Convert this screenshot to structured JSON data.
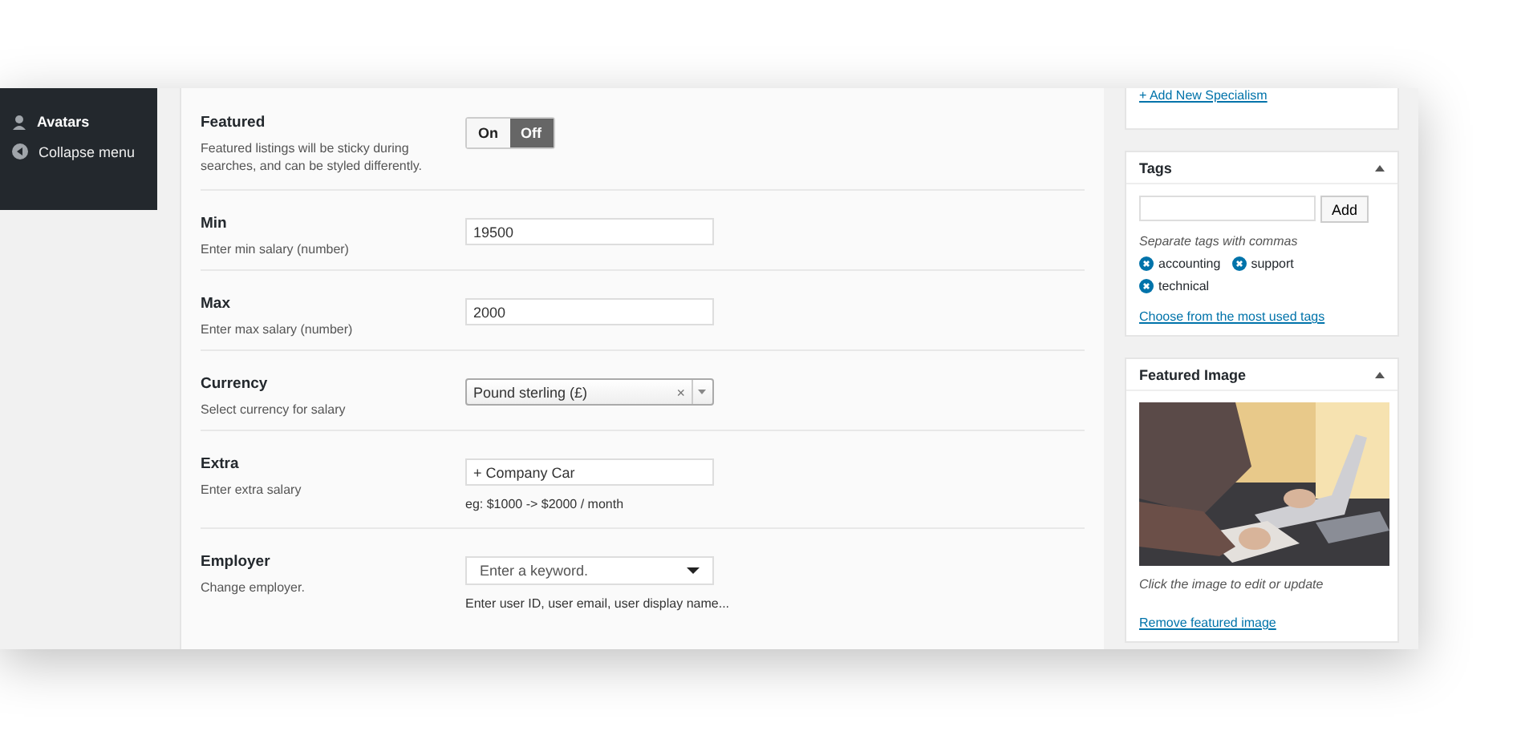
{
  "sidebar": {
    "items": [
      {
        "label": "Avatars",
        "selected": true
      },
      {
        "label": "Collapse menu",
        "selected": false
      }
    ]
  },
  "fields": [
    {
      "kind": "toggle",
      "label": "Featured",
      "description": "Featured listings will be sticky during searches, and can be styled differently.",
      "options": [
        {
          "label": "On",
          "selected": false
        },
        {
          "label": "Off",
          "selected": true
        }
      ]
    },
    {
      "kind": "text",
      "label": "Min",
      "description": "Enter min salary (number)",
      "value": "19500"
    },
    {
      "kind": "text",
      "label": "Max",
      "description": "Enter max salary (number)",
      "value": "2000"
    },
    {
      "kind": "select",
      "label": "Currency",
      "description": "Select currency for salary",
      "value": "Pound sterling (£)",
      "clear": "×"
    },
    {
      "kind": "text",
      "label": "Extra",
      "description": "Enter extra salary",
      "value": "+ Company Car",
      "hint": "eg: $1000 -> $2000 / month"
    },
    {
      "kind": "search",
      "label": "Employer",
      "description": "Change employer.",
      "placeholder": "Enter a keyword.",
      "hint": "Enter user ID, user email, user display name..."
    }
  ],
  "specialism": {
    "link": "+ Add New Specialism"
  },
  "tags_box": {
    "title": "Tags",
    "button": "Add",
    "help": "Separate tags with commas",
    "tags": [
      "accounting",
      "support",
      "technical"
    ],
    "link": "Choose from the most used tags"
  },
  "image_box": {
    "title": "Featured Image",
    "help": "Click the image to edit or update",
    "link": "Remove featured image"
  }
}
